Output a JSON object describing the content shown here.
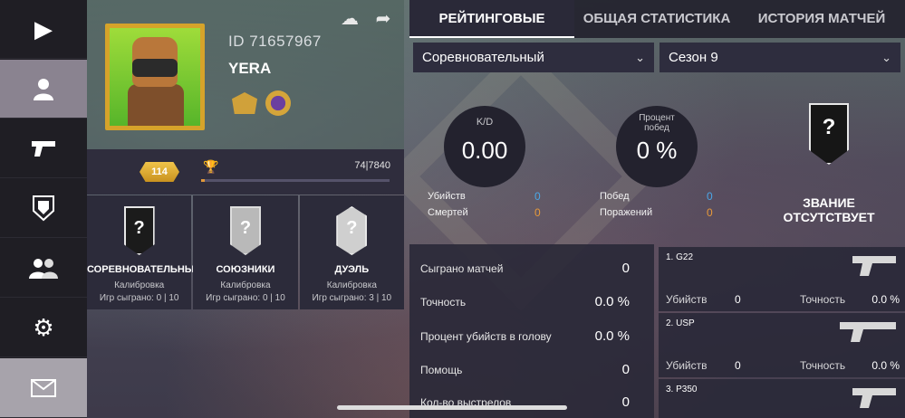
{
  "profile": {
    "id_text": "ID 71657967",
    "name": "YERA",
    "level": "114",
    "xp_text": "74|7840",
    "xp_progress": 0.009
  },
  "modes": [
    {
      "title": "СОРЕВНОВАТЕЛЬНЫЙ",
      "status": "Калибровка",
      "games": "Игр сыграно: 0 | 10"
    },
    {
      "title": "СОЮЗНИКИ",
      "status": "Калибровка",
      "games": "Игр сыграно: 0 | 10"
    },
    {
      "title": "ДУЭЛЬ",
      "status": "Калибровка",
      "games": "Игр сыграно: 3 | 10"
    }
  ],
  "tabs": [
    "РЕЙТИНГОВЫЕ",
    "ОБЩАЯ СТАТИСТИКА",
    "ИСТОРИЯ МАТЧЕЙ"
  ],
  "filters": {
    "mode": "Соревновательный",
    "season": "Сезон 9"
  },
  "kd": {
    "label": "K/D",
    "value": "0.00"
  },
  "winrate": {
    "label": "Процент побед",
    "value": "0 %"
  },
  "stats_left": [
    {
      "label": "Убийств",
      "value": "0"
    },
    {
      "label": "Смертей",
      "value": "0"
    }
  ],
  "stats_right": [
    {
      "label": "Побед",
      "value": "0"
    },
    {
      "label": "Поражений",
      "value": "0"
    }
  ],
  "rank_text": "ЗВАНИЕ ОТСУТСТВУЕТ",
  "totals": [
    {
      "label": "Сыграно матчей",
      "value": "0"
    },
    {
      "label": "Точность",
      "value": "0.0 %"
    },
    {
      "label": "Процент убийств в голову",
      "value": "0.0 %"
    },
    {
      "label": "Помощь",
      "value": "0"
    },
    {
      "label": "Кол-во выстрелов",
      "value": "0"
    }
  ],
  "weapons": [
    {
      "name": "1. G22",
      "kills_label": "Убийств",
      "kills": "0",
      "acc_label": "Точность",
      "acc": "0.0 %"
    },
    {
      "name": "2. USP",
      "kills_label": "Убийств",
      "kills": "0",
      "acc_label": "Точность",
      "acc": "0.0 %"
    },
    {
      "name": "3. P350",
      "kills_label": "",
      "kills": "",
      "acc_label": "",
      "acc": ""
    }
  ],
  "colors": {
    "accent_blue": "#4aa7e8",
    "accent_orange": "#e89a3a",
    "gold": "#d6a32a"
  },
  "icons": {
    "nav": [
      "play-icon",
      "profile-icon",
      "pistol-icon",
      "shield-icon",
      "friends-icon",
      "gear-icon",
      "mail-icon"
    ],
    "top": [
      "cloud-download-icon",
      "share-icon"
    ]
  }
}
